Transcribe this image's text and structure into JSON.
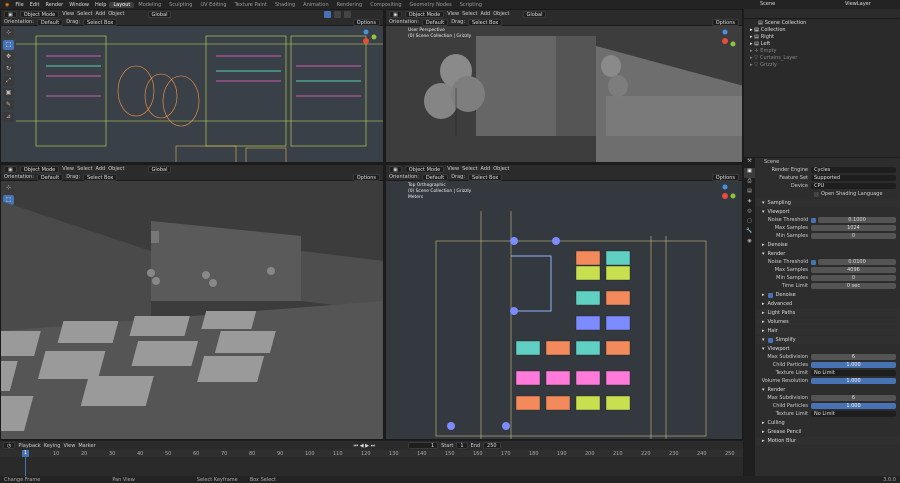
{
  "topbar": {
    "menus": [
      "File",
      "Edit",
      "Render",
      "Window",
      "Help"
    ],
    "workspaces": [
      "Layout",
      "Modeling",
      "Sculpting",
      "UV Editing",
      "Texture Paint",
      "Shading",
      "Animation",
      "Rendering",
      "Compositing",
      "Geometry Nodes",
      "Scripting"
    ],
    "scene": "Scene",
    "viewlayer": "ViewLayer"
  },
  "vp_header": {
    "mode": "Object Mode",
    "view": "View",
    "select": "Select",
    "add": "Add",
    "object": "Object",
    "orientation_label": "Orientation:",
    "orientation": "Default",
    "drag": "Drag:",
    "select_box": "Select Box",
    "global": "Global",
    "options": "Options"
  },
  "vp2": {
    "line1": "User Perspective",
    "line2": "(0) Scene Collection | Grizzly"
  },
  "vp4": {
    "line1": "Top Orthographic",
    "line2": "(0) Scene Collection | Grizzly",
    "line3": "Meters"
  },
  "outliner": {
    "title": "Scene Collection",
    "items": [
      "Collection",
      "Right",
      "Left",
      "Empty",
      "Curtains_Layer",
      "Grizzly"
    ]
  },
  "props": {
    "scene_label": "Scene",
    "render_engine_label": "Render Engine",
    "render_engine": "Cycles",
    "feature_set_label": "Feature Set",
    "feature_set": "Supported",
    "device_label": "Device",
    "device": "CPU",
    "osl_label": "Open Shading Language",
    "sampling": "Sampling",
    "viewport": "Viewport",
    "noise_threshold_label": "Noise Threshold",
    "vp_noise": "0.1000",
    "max_samples_label": "Max Samples",
    "vp_max": "1024",
    "min_samples_label": "Min Samples",
    "vp_min": "0",
    "denoise": "Denoise",
    "render": "Render",
    "r_noise": "0.0100",
    "r_max": "4096",
    "r_min": "0",
    "time_limit_label": "Time Limit",
    "time_limit": "0 sec",
    "advanced": "Advanced",
    "light_paths": "Light Paths",
    "volumes": "Volumes",
    "hair": "Hair",
    "simplify": "Simplify",
    "viewport2": "Viewport",
    "max_subdiv_label": "Max Subdivision",
    "vp_subdiv": "6",
    "child_particles_label": "Child Particles",
    "vp_child": "1.000",
    "texture_limit_label": "Texture Limit",
    "texture_limit": "No Limit",
    "volume_res_label": "Volume Resolution",
    "vp_volres": "1.000",
    "render2": "Render",
    "r_subdiv": "6",
    "r_child": "1.000",
    "culling": "Culling",
    "grease_pencil": "Grease Pencil",
    "motion_blur": "Motion Blur"
  },
  "timeline": {
    "playback": "Playback",
    "keying": "Keying",
    "view": "View",
    "marker": "Marker",
    "current": "1",
    "start_label": "Start",
    "start": "1",
    "end_label": "End",
    "end": "250",
    "ticks": [
      "0",
      "10",
      "20",
      "30",
      "40",
      "50",
      "60",
      "70",
      "80",
      "90",
      "100",
      "110",
      "120",
      "130",
      "140",
      "150",
      "160",
      "170",
      "180",
      "190",
      "200",
      "210",
      "220",
      "230",
      "240",
      "250"
    ]
  },
  "status": {
    "items": [
      "Change Frame",
      "Pan View",
      "Select Keyframe",
      "Box Select"
    ],
    "version": "3.0.0"
  }
}
